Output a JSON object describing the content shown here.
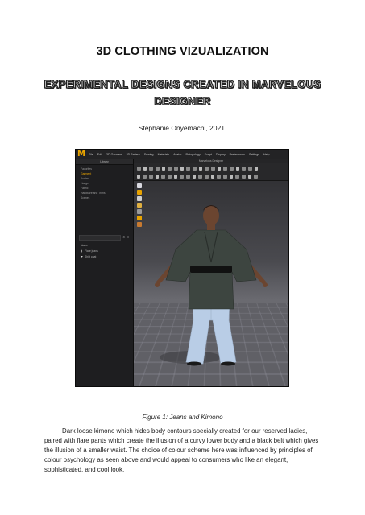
{
  "document": {
    "title": "3D CLOTHING VIZUALIZATION",
    "subtitle": "EXPERIMENTAL DESIGNS CREATED IN MARVELOUS DESIGNER",
    "author_line": "Stephanie Onyemachi, 2021.",
    "caption": "Figure 1: Jeans and Kimono",
    "body": "Dark loose kimono which hides body contours specially created for our reserved ladies, paired with flare pants which create the illusion of a curvy lower body and a black belt which gives the illusion of a smaller waist. The choice of colour scheme here was influenced by principles of colour psychology as seen above and would appeal to consumers who like an elegant, sophisticated, and cool look."
  },
  "app": {
    "logo": "M",
    "menu": [
      "File",
      "Edit",
      "3D Garment",
      "2D Pattern",
      "Sewing",
      "Materials",
      "Avatar",
      "Retopology",
      "Script",
      "Display",
      "Preferences",
      "Settings",
      "Help"
    ],
    "library_header": "Library",
    "library_items": [
      {
        "label": "Favorites",
        "active": false
      },
      {
        "label": "Garment",
        "active": true
      },
      {
        "label": "Avatar",
        "active": false
      },
      {
        "label": "Hanger",
        "active": false
      },
      {
        "label": "Fabric",
        "active": false
      },
      {
        "label": "Hardware and Trims",
        "active": false
      },
      {
        "label": "Scenes",
        "active": false
      }
    ],
    "object_header": "Name",
    "objects": [
      {
        "label": "Flare jeans",
        "icon": "pants-icon"
      },
      {
        "label": "Shirt coat",
        "icon": "shirt-icon"
      }
    ],
    "viewport_title": "Marvelous Designer"
  },
  "colors": {
    "accent": "#e8a300",
    "kimono": "#3d4540",
    "jeans": "#b9cde6",
    "skin": "#6b4530",
    "belt": "#111111"
  }
}
